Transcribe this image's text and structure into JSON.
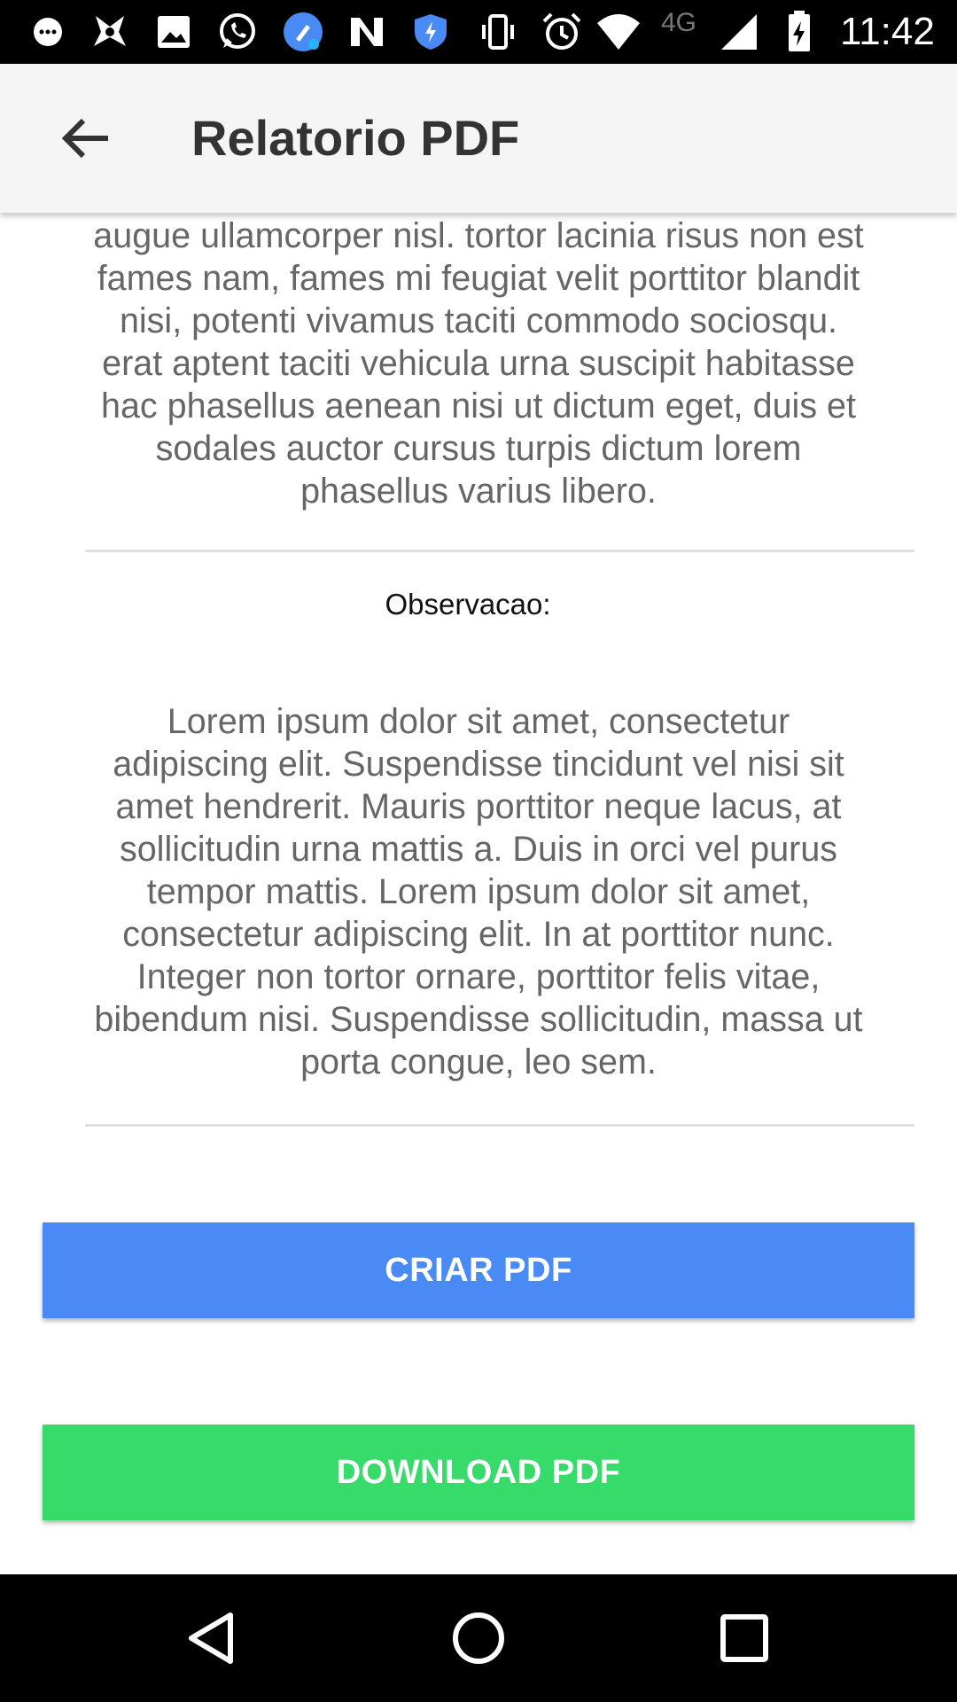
{
  "status_bar": {
    "time": "11:42",
    "network": "4G",
    "icons": [
      "message-icon",
      "app-icon",
      "gallery-icon",
      "whatsapp-icon",
      "cleaner-icon",
      "n-app-icon",
      "shield-icon",
      "vibrate-icon",
      "alarm-icon",
      "wifi-icon",
      "signal-icon",
      "battery-charging-icon"
    ]
  },
  "app_bar": {
    "title": "Relatorio PDF",
    "back_icon": "arrow-left-icon"
  },
  "content": {
    "paragraph_top": "augue ullamcorper nisl. tortor lacinia risus non est fames nam, fames mi feugiat velit porttitor blandit nisi, potenti vivamus taciti commodo sociosqu. erat aptent taciti vehicula urna suscipit habitasse hac phasellus aenean nisi ut dictum eget, duis et sodales auctor cursus turpis dictum lorem phasellus varius libero.",
    "observation_label": "Observacao:",
    "observation_text": "Lorem ipsum dolor sit amet, consectetur adipiscing elit. Suspendisse tincidunt vel nisi sit amet hendrerit. Mauris porttitor neque lacus, at sollicitudin urna mattis a. Duis in orci vel purus tempor mattis. Lorem ipsum dolor sit amet, consectetur adipiscing elit. In at porttitor nunc. Integer non tortor ornare, porttitor felis vitae, bibendum nisi. Suspendisse sollicitudin, massa ut porta congue, leo sem."
  },
  "buttons": {
    "create_label": "CRIAR PDF",
    "download_label": "DOWNLOAD PDF"
  },
  "colors": {
    "create_button": "#4a8af4",
    "download_button": "#37db6a",
    "app_bar": "#f5f5f5",
    "text": "#666666"
  },
  "nav_bar": {
    "icons": [
      "back-triangle-icon",
      "home-circle-icon",
      "recents-square-icon"
    ]
  }
}
